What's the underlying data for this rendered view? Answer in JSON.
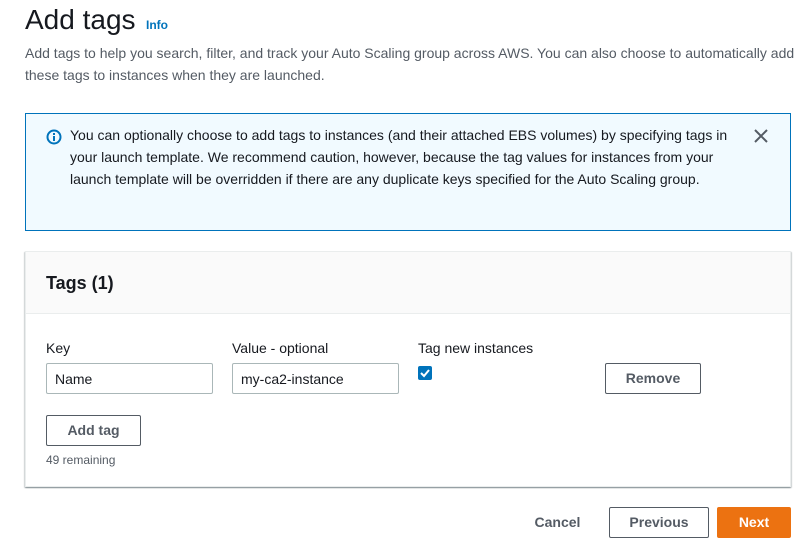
{
  "header": {
    "title": "Add tags",
    "info_link": "Info",
    "description": "Add tags to help you search, filter, and track your Auto Scaling group across AWS. You can also choose to automatically add these tags to instances when they are launched."
  },
  "alert": {
    "icon": "info-circle-icon",
    "text": "You can optionally choose to add tags to instances (and their attached EBS volumes) by specifying tags in your launch template. We recommend caution, however, because the tag values for instances from your launch template will be overridden if there are any duplicate keys specified for the Auto Scaling group.",
    "close_icon": "close-icon"
  },
  "tags_panel": {
    "title": "Tags (1)",
    "columns": {
      "key": "Key",
      "value": "Value - optional",
      "tag_new_instances": "Tag new instances"
    },
    "rows": [
      {
        "key": "Name",
        "value": "my-ca2-instance",
        "tag_new_instances": true,
        "remove_label": "Remove"
      }
    ],
    "add_tag_label": "Add tag",
    "remaining_text": "49 remaining"
  },
  "footer": {
    "cancel_label": "Cancel",
    "previous_label": "Previous",
    "next_label": "Next"
  },
  "colors": {
    "link": "#0073bb",
    "primary_button": "#ec7211",
    "alert_background": "#f1faff",
    "alert_border": "#0073bb"
  }
}
